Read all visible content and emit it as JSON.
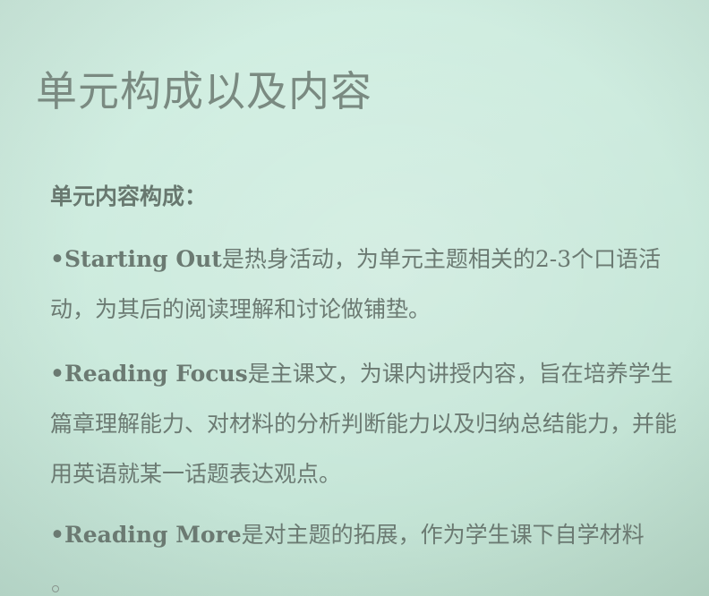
{
  "slide": {
    "title": "单元构成以及内容",
    "section_heading": "单元内容构成：",
    "items": [
      {
        "lead": "•Starting Out",
        "text": "是热身活动，为单元主题相关的2-3个口语活动，为其后的阅读理解和讨论做铺垫。"
      },
      {
        "lead": "•Reading Focus",
        "text": "是主课文，为课内讲授内容，旨在培养学生篇章理解能力、对材料的分析判断能力以及归纳总结能力，并能用英语就某一话题表达观点。"
      },
      {
        "lead": "•Reading More",
        "text": "是对主题的拓展，作为学生课下自学材料"
      }
    ]
  }
}
